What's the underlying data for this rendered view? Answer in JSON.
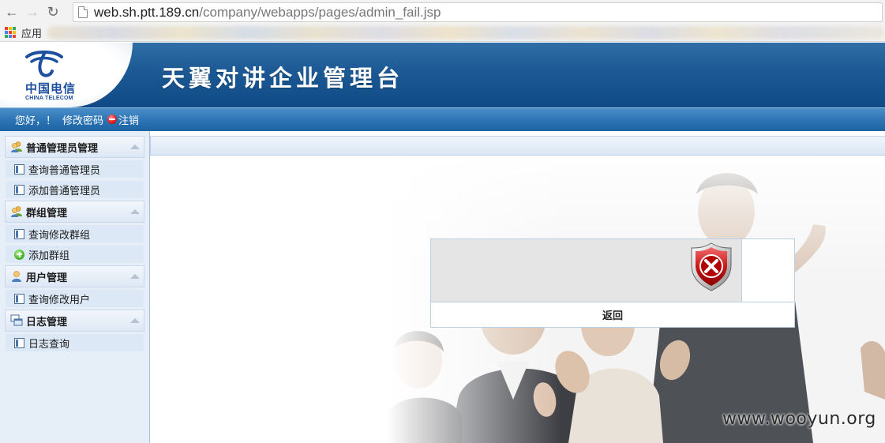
{
  "browser": {
    "back_icon": "arrow-left-icon",
    "forward_icon": "arrow-right-icon",
    "reload_icon": "reload-icon",
    "url_host": "web.sh.ptt.189.cn",
    "url_path": "/company/webapps/pages/admin_fail.jsp",
    "apps_label": "应用"
  },
  "header": {
    "logo_cn": "中国电信",
    "logo_en": "CHINA TELECOM",
    "title": "天翼对讲企业管理台",
    "brand_color": "#1c5994"
  },
  "userbar": {
    "greeting": "您好，！",
    "change_password": "修改密码",
    "logout": "注销"
  },
  "sidebar": {
    "groups": [
      {
        "label": "普通管理员管理",
        "icon": "users-icon",
        "items": [
          {
            "label": "查询普通管理员",
            "icon": "window-icon"
          },
          {
            "label": "添加普通管理员",
            "icon": "window-icon"
          }
        ]
      },
      {
        "label": "群组管理",
        "icon": "users-icon",
        "items": [
          {
            "label": "查询修改群组",
            "icon": "window-icon"
          },
          {
            "label": "添加群组",
            "icon": "add-icon"
          }
        ]
      },
      {
        "label": "用户管理",
        "icon": "user-icon",
        "items": [
          {
            "label": "查询修改用户",
            "icon": "window-icon"
          }
        ]
      },
      {
        "label": "日志管理",
        "icon": "log-icon",
        "items": [
          {
            "label": "日志查询",
            "icon": "window-icon"
          }
        ]
      }
    ]
  },
  "dialog": {
    "icon": "error-shield-icon",
    "back_label": "返回"
  },
  "watermark": "www.wooyun.org"
}
